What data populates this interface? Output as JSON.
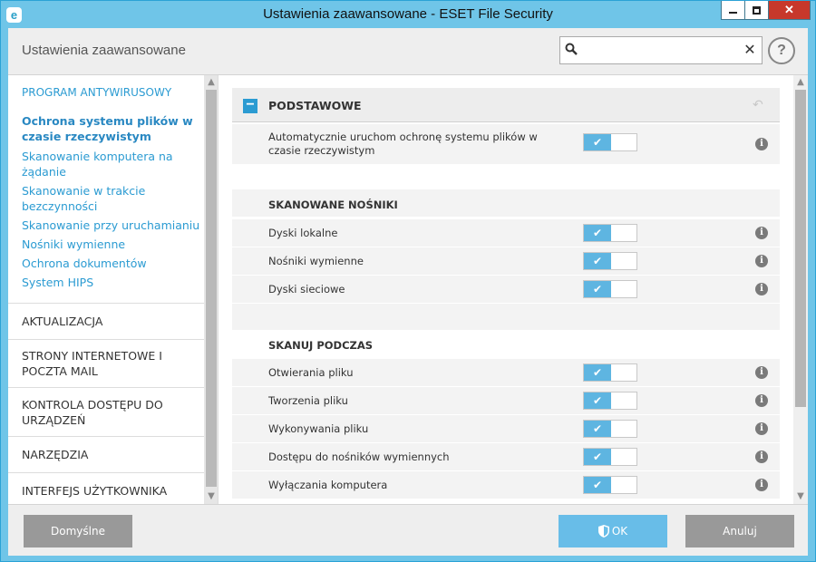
{
  "window": {
    "title": "Ustawienia zaawansowane - ESET File Security",
    "app_icon": "e",
    "close_glyph": "✕"
  },
  "header": {
    "page_title": "Ustawienia zaawansowane",
    "search_placeholder": "",
    "search_value": "",
    "clear_glyph": "✕",
    "help_glyph": "?"
  },
  "sidebar": {
    "section_title": "PROGRAM ANTYWIRUSOWY",
    "links": [
      {
        "label": "Ochrona systemu plików w czasie rzeczywistym",
        "active": true
      },
      {
        "label": "Skanowanie komputera na żądanie",
        "active": false
      },
      {
        "label": "Skanowanie w trakcie bezczynności",
        "active": false
      },
      {
        "label": "Skanowanie przy uruchamianiu",
        "active": false
      },
      {
        "label": "Nośniki wymienne",
        "active": false
      },
      {
        "label": "Ochrona dokumentów",
        "active": false
      },
      {
        "label": "System HIPS",
        "active": false
      }
    ],
    "categories": [
      "AKTUALIZACJA",
      "STRONY INTERNETOWE I POCZTA MAIL",
      "KONTROLA DOSTĘPU DO URZĄDZEŃ",
      "NARZĘDZIA",
      "INTERFEJS UŻYTKOWNIKA"
    ]
  },
  "main": {
    "section_title": "PODSTAWOWE",
    "collapse_glyph": "−",
    "revert_glyph": "↶",
    "auto_start": {
      "label": "Automatycznie uruchom ochronę systemu plików w czasie rzeczywistym",
      "enabled": true
    },
    "scanned_media": {
      "title": "SKANOWANE NOŚNIKI",
      "items": [
        {
          "label": "Dyski lokalne",
          "enabled": true
        },
        {
          "label": "Nośniki wymienne",
          "enabled": true
        },
        {
          "label": "Dyski sieciowe",
          "enabled": true
        }
      ]
    },
    "scan_on": {
      "title": "SKANUJ PODCZAS",
      "items": [
        {
          "label": "Otwierania pliku",
          "enabled": true
        },
        {
          "label": "Tworzenia pliku",
          "enabled": true
        },
        {
          "label": "Wykonywania pliku",
          "enabled": true
        },
        {
          "label": "Dostępu do nośników wymiennych",
          "enabled": true
        },
        {
          "label": "Wyłączania komputera",
          "enabled": true
        }
      ]
    },
    "check_glyph": "✔",
    "info_glyph": "i"
  },
  "footer": {
    "defaults_label": "Domyślne",
    "ok_label": "OK",
    "cancel_label": "Anuluj"
  },
  "colors": {
    "titlebar": "#6fc5e8",
    "accent": "#2b9bd2",
    "toggle_on": "#5eb5e1",
    "close_button": "#c7382b",
    "button_gray": "#999999"
  }
}
